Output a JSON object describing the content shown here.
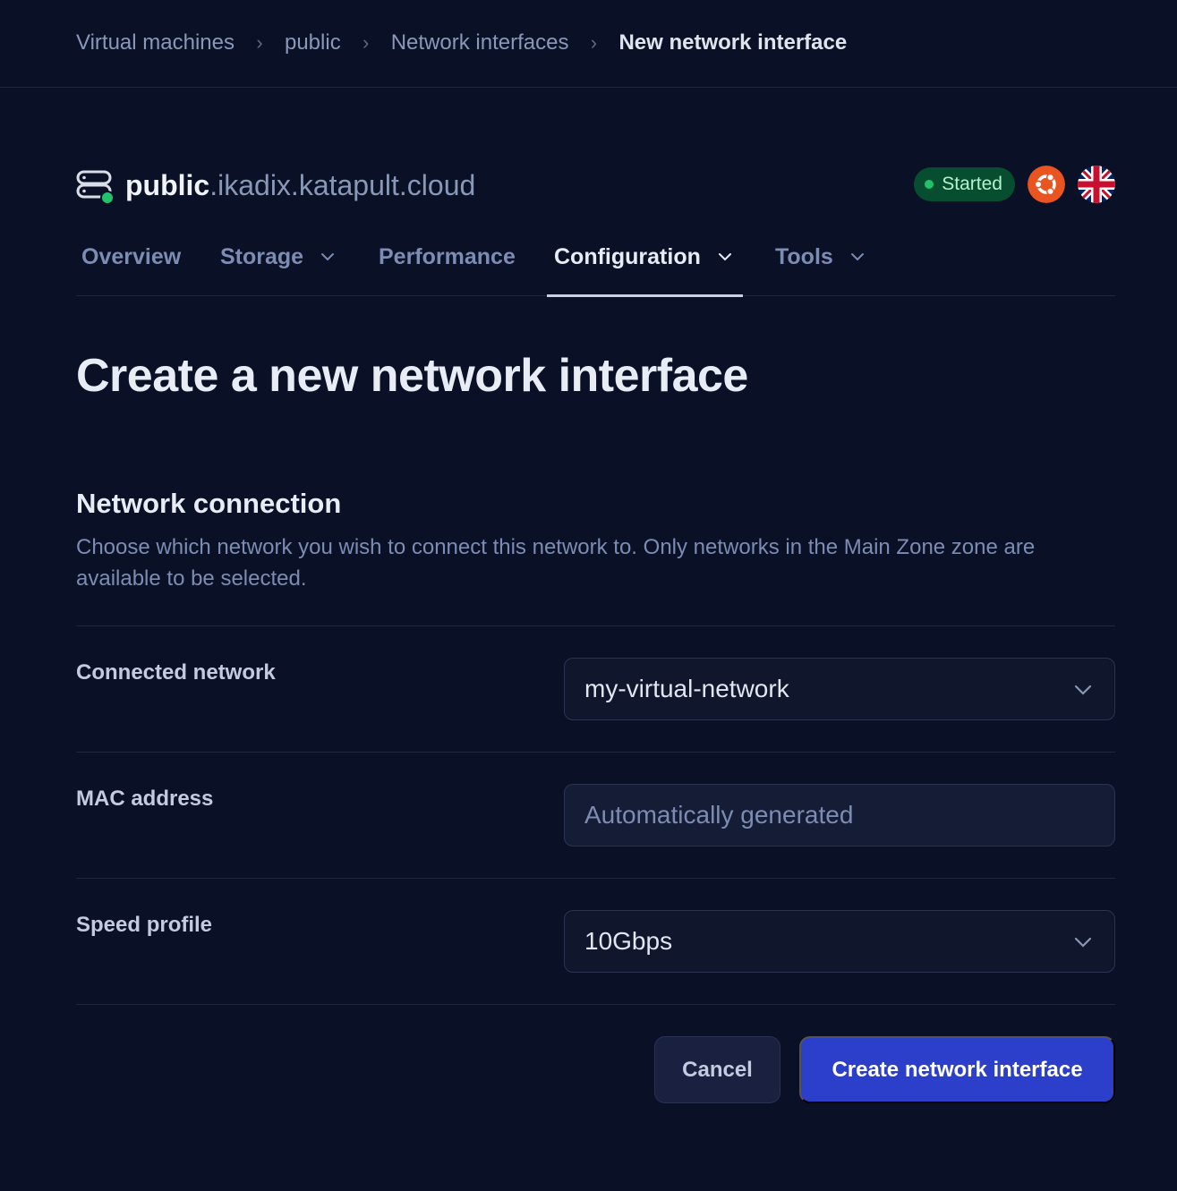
{
  "breadcrumb": [
    {
      "label": "Virtual machines"
    },
    {
      "label": "public"
    },
    {
      "label": "Network interfaces"
    },
    {
      "label": "New network interface"
    }
  ],
  "vm": {
    "host": "public",
    "domain": ".ikadix.katapult.cloud",
    "icon": "server-icon",
    "status": "Started",
    "status_color": "#22c26b",
    "os_icon": "ubuntu-icon",
    "region_icon": "uk-flag-icon"
  },
  "tabs": [
    {
      "label": "Overview",
      "dropdown": false,
      "active": false
    },
    {
      "label": "Storage",
      "dropdown": true,
      "active": false
    },
    {
      "label": "Performance",
      "dropdown": false,
      "active": false
    },
    {
      "label": "Configuration",
      "dropdown": true,
      "active": true
    },
    {
      "label": "Tools",
      "dropdown": true,
      "active": false
    }
  ],
  "page": {
    "title": "Create a new network interface"
  },
  "section": {
    "title": "Network connection",
    "description": "Choose which network you wish to connect this network to. Only networks in the Main Zone zone are available to be selected."
  },
  "form": {
    "connected_network": {
      "label": "Connected network",
      "value": "my-virtual-network"
    },
    "mac_address": {
      "label": "MAC address",
      "value": "",
      "placeholder": "Automatically generated"
    },
    "speed_profile": {
      "label": "Speed profile",
      "value": "10Gbps"
    }
  },
  "actions": {
    "cancel_label": "Cancel",
    "submit_label": "Create network interface",
    "primary_color": "#2c3fcb"
  }
}
